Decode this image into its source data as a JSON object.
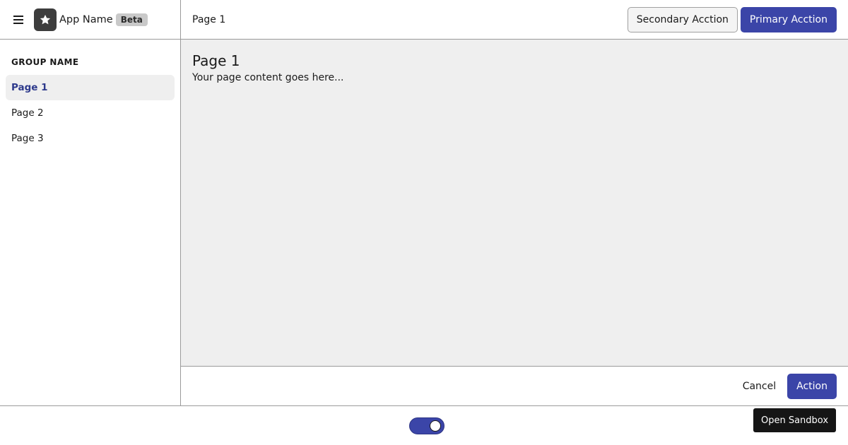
{
  "app": {
    "name": "App Name",
    "badge": "Beta"
  },
  "icons": {
    "menu": "menu-icon",
    "logo": "star-icon"
  },
  "sidebar": {
    "group_name": "GROUP NAME",
    "items": [
      {
        "label": "Page 1",
        "active": true
      },
      {
        "label": "Page 2",
        "active": false
      },
      {
        "label": "Page 3",
        "active": false
      }
    ]
  },
  "topbar": {
    "breadcrumb": "Page 1",
    "secondary_label": "Secondary Acction",
    "primary_label": "Primary Acction"
  },
  "content": {
    "title": "Page 1",
    "text": "Your page content goes here..."
  },
  "footer": {
    "cancel_label": "Cancel",
    "action_label": "Action"
  },
  "bottom": {
    "toggle_on": true,
    "sandbox_label": "Open Sandbox"
  },
  "colors": {
    "accent": "#3b45a8",
    "active_text": "#2e3a8c",
    "content_bg": "#efefef",
    "dark_button": "#151515"
  }
}
